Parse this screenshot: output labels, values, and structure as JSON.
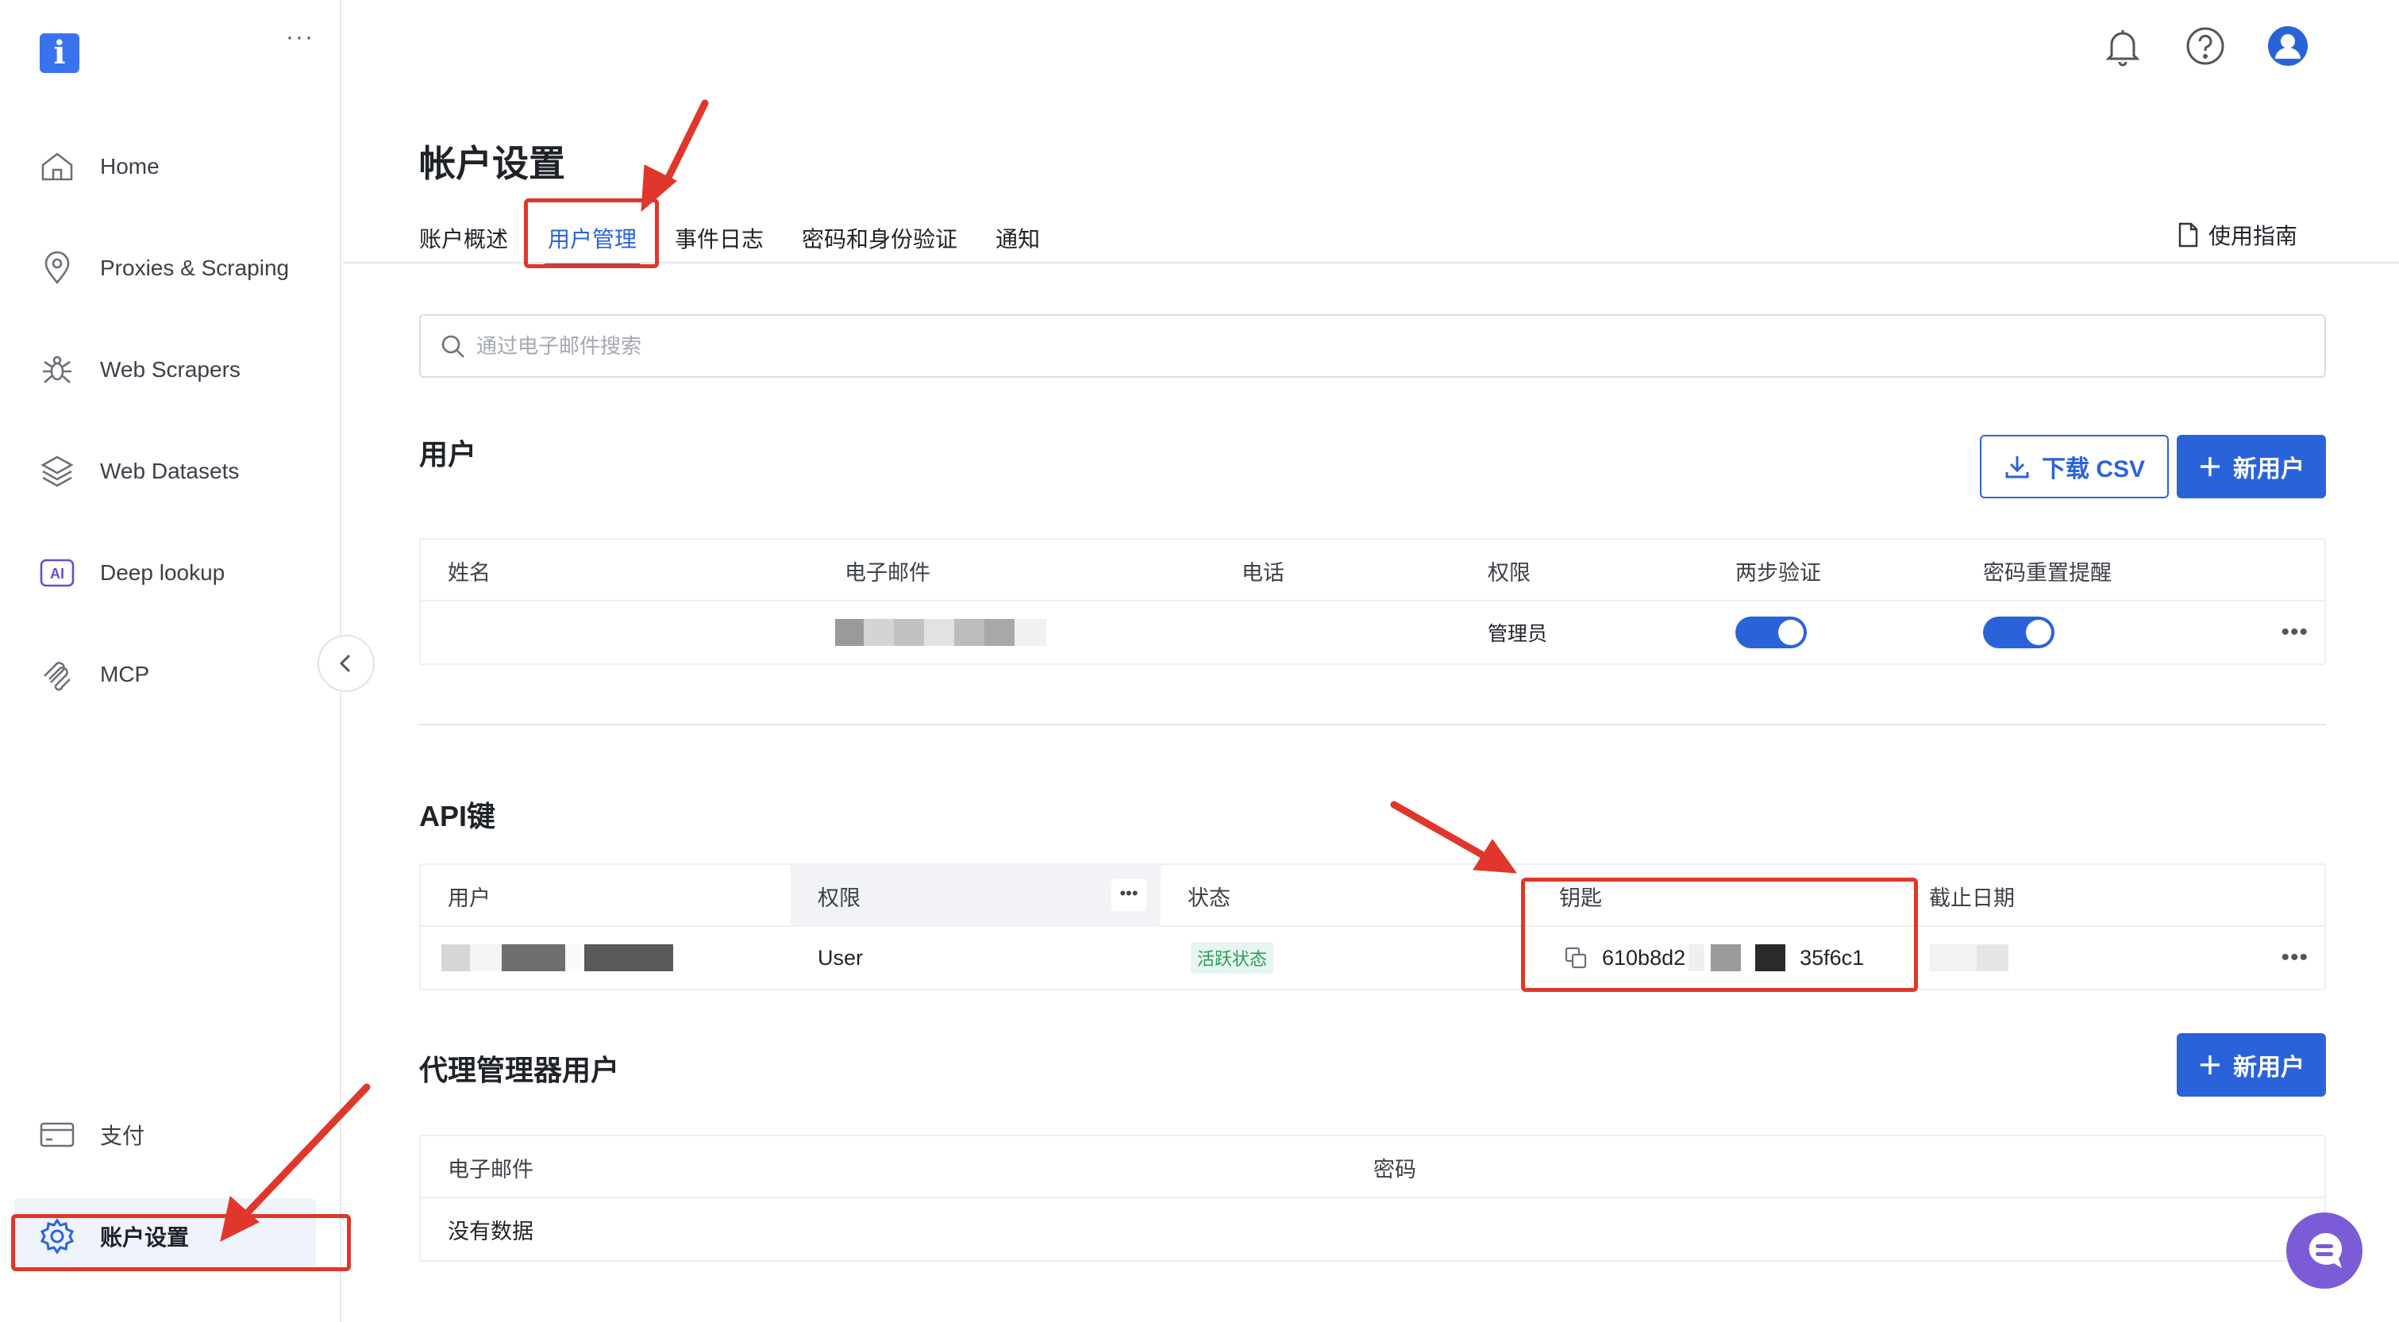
{
  "sidebar": {
    "logo": "i",
    "more": "···",
    "items": [
      {
        "label": "Home",
        "icon": "home-icon"
      },
      {
        "label": "Proxies & Scraping",
        "icon": "location-pin-icon"
      },
      {
        "label": "Web Scrapers",
        "icon": "spider-icon"
      },
      {
        "label": "Web Datasets",
        "icon": "layers-icon"
      },
      {
        "label": "Deep lookup",
        "icon": "ai-badge-icon",
        "badge": "AI"
      },
      {
        "label": "MCP",
        "icon": "mcp-icon"
      },
      {
        "label": "支付",
        "icon": "card-icon"
      },
      {
        "label": "账户设置",
        "icon": "gear-icon"
      }
    ]
  },
  "header": {
    "title": "帐户设置",
    "tabs": [
      "账户概述",
      "用户管理",
      "事件日志",
      "密码和身份验证",
      "通知"
    ],
    "active_tab": "用户管理",
    "guide": "使用指南"
  },
  "search": {
    "placeholder": "通过电子邮件搜索"
  },
  "users": {
    "title": "用户",
    "download_label": "下载 CSV",
    "new_user_label": "新用户",
    "columns": [
      "姓名",
      "电子邮件",
      "电话",
      "权限",
      "两步验证",
      "密码重置提醒"
    ],
    "rows": [
      {
        "name": "",
        "email": "",
        "phone": "",
        "permission": "管理员",
        "two_factor": true,
        "password_reminder": true
      }
    ]
  },
  "api_keys": {
    "title": "API键",
    "columns": [
      "用户",
      "权限",
      "状态",
      "钥匙",
      "截止日期"
    ],
    "rows": [
      {
        "user": "",
        "permission": "User",
        "status": "活跃状态",
        "key_start": "610b8d2",
        "key_end": "35f6c1",
        "expiry": ""
      }
    ]
  },
  "proxy_users": {
    "title": "代理管理器用户",
    "new_user_label": "新用户",
    "columns": [
      "电子邮件",
      "密码"
    ],
    "empty": "没有数据"
  },
  "colors": {
    "accent": "#2a63d9",
    "annotation": "#e0362b",
    "chat": "#7b5bd6"
  }
}
